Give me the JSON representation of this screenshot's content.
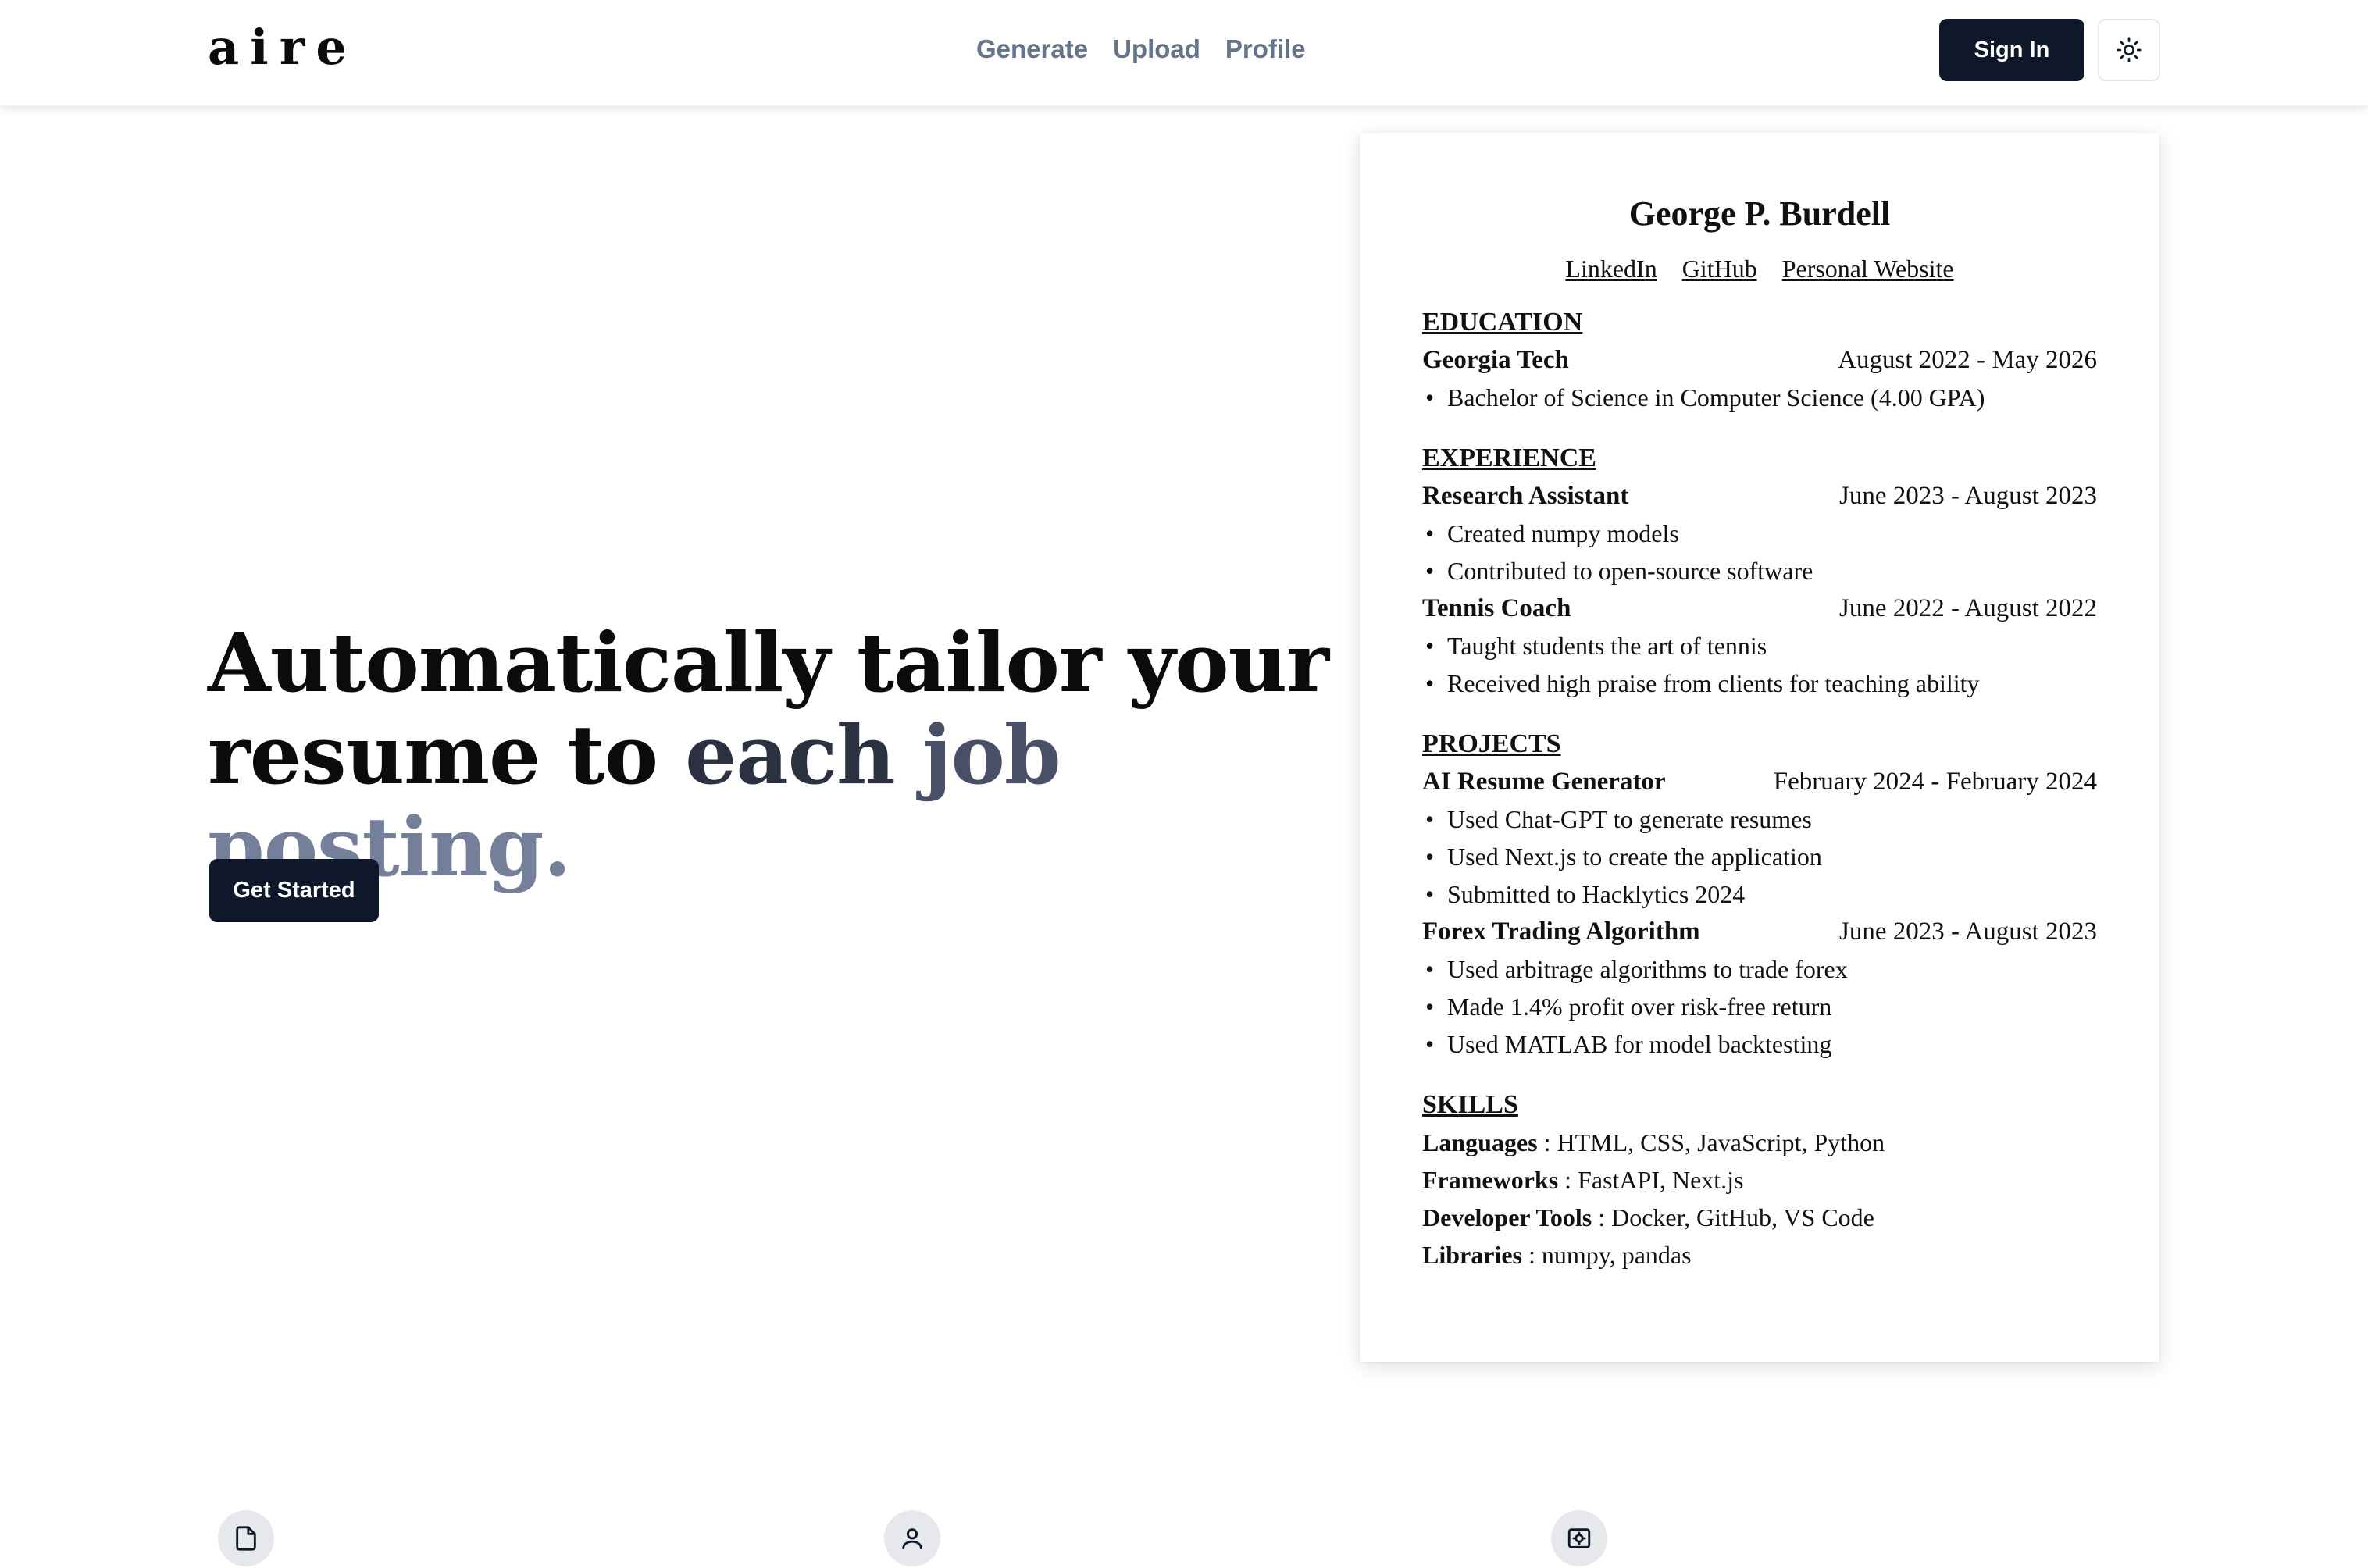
{
  "brand": {
    "logo_text": "aire"
  },
  "nav": {
    "links": [
      "Generate",
      "Upload",
      "Profile"
    ],
    "sign_in": "Sign In",
    "theme_icon": "sun-icon"
  },
  "hero": {
    "title_line1": "Automatically tailor your",
    "title_line2_a": "resume to ",
    "title_line2_b": "each ",
    "title_line2_c": "job ",
    "title_line2_d": "posting.",
    "cta": "Get Started"
  },
  "resume": {
    "name": "George P. Burdell",
    "links": [
      "LinkedIn",
      "GitHub",
      "Personal Website"
    ],
    "education": {
      "title": "EDUCATION",
      "entries": [
        {
          "org": "Georgia Tech",
          "dates": "August 2022 - May 2026",
          "bullets": [
            "Bachelor of Science in Computer Science (4.00 GPA)"
          ]
        }
      ]
    },
    "experience": {
      "title": "EXPERIENCE",
      "entries": [
        {
          "org": "Research Assistant",
          "dates": "June 2023 - August 2023",
          "bullets": [
            "Created numpy models",
            "Contributed to open-source software"
          ]
        },
        {
          "org": "Tennis Coach",
          "dates": "June 2022 - August 2022",
          "bullets": [
            "Taught students the art of tennis",
            "Received high praise from clients for teaching ability"
          ]
        }
      ]
    },
    "projects": {
      "title": "PROJECTS",
      "entries": [
        {
          "org": "AI Resume Generator",
          "dates": "February 2024 - February 2024",
          "bullets": [
            "Used Chat-GPT to generate resumes",
            "Used Next.js to create the application",
            "Submitted to Hacklytics 2024"
          ]
        },
        {
          "org": "Forex Trading Algorithm",
          "dates": "June 2023 - August 2023",
          "bullets": [
            "Used arbitrage algorithms to trade forex",
            "Made 1.4% profit over risk-free return",
            "Used MATLAB for model backtesting"
          ]
        }
      ]
    },
    "skills": {
      "title": "SKILLS",
      "items": [
        {
          "label": "Languages",
          "value": " : HTML, CSS, JavaScript, Python"
        },
        {
          "label": "Frameworks",
          "value": " : FastAPI, Next.js"
        },
        {
          "label": "Developer Tools",
          "value": " : Docker, GitHub, VS Code"
        },
        {
          "label": "Libraries",
          "value": " : numpy, pandas"
        }
      ]
    }
  },
  "features": {
    "icons": [
      "document-icon",
      "user-icon",
      "scan-icon"
    ]
  },
  "colors": {
    "primary": "#0f172a",
    "nav_link": "#64748b",
    "accent_fade": "#74809a"
  }
}
